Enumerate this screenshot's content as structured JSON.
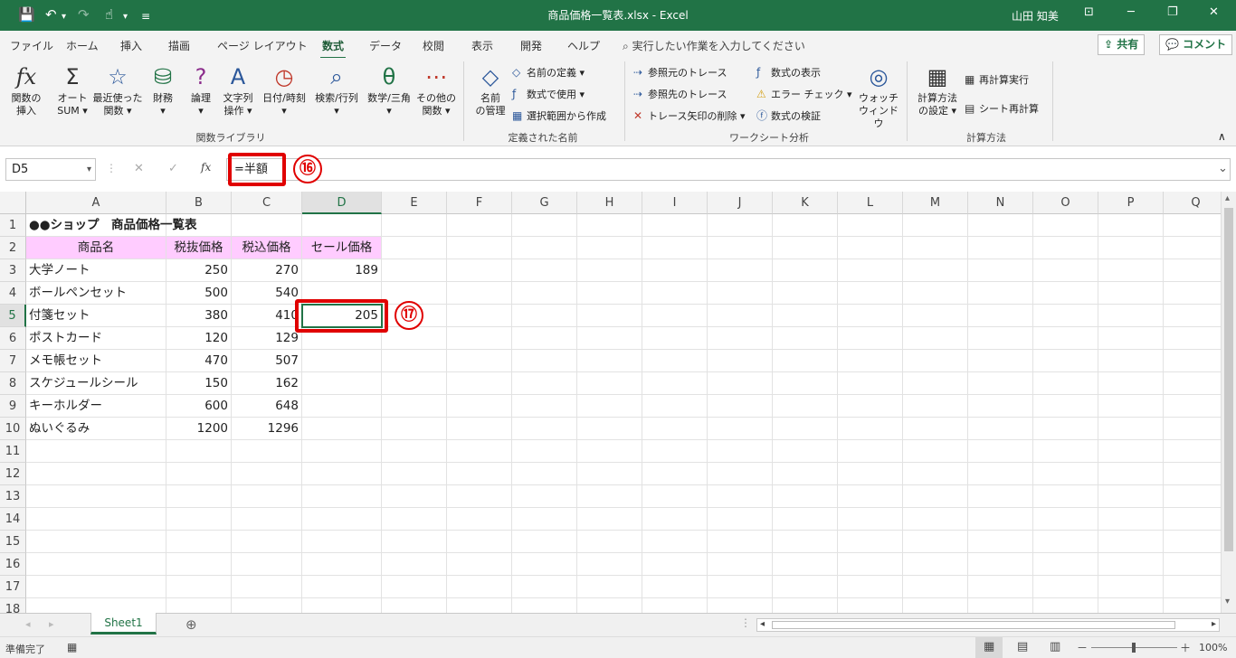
{
  "window": {
    "title": "商品価格一覧表.xlsx - Excel",
    "user": "山田 知美",
    "ribbon_display_glyph": "⊡",
    "minimize_glyph": "─",
    "restore_glyph": "❐",
    "close_glyph": "✕"
  },
  "qat": {
    "save_glyph": "💾",
    "undo_glyph": "↶",
    "dropdown_glyph": "▾",
    "redo_glyph": "↷",
    "touch_glyph": "☝",
    "customize_glyph": "≡"
  },
  "tabs": [
    "ファイル",
    "ホーム",
    "挿入",
    "描画",
    "ページ レイアウト",
    "数式",
    "データ",
    "校閲",
    "表示",
    "開発",
    "ヘルプ"
  ],
  "active_tab": "数式",
  "tellme": "実行したい作業を入力してください",
  "tellme_icon": "⌕",
  "share_label": "共有",
  "share_icon": "⇪",
  "comment_label": "コメント",
  "comment_icon": "💬",
  "ribbon": {
    "insert_function": {
      "line1": "関数の",
      "line2": "挿入",
      "glyph": "fx"
    },
    "autosum": {
      "line1": "オート",
      "line2": "SUM ▾",
      "glyph": "Σ"
    },
    "recent": {
      "line1": "最近使った",
      "line2": "関数 ▾",
      "glyph": "☆"
    },
    "financial": {
      "line1": "財務",
      "line2": "▾",
      "glyph": "⛁"
    },
    "logical": {
      "line1": "論理",
      "line2": "▾",
      "glyph": "?"
    },
    "text": {
      "line1": "文字列",
      "line2": "操作 ▾",
      "glyph": "A"
    },
    "datetime": {
      "line1": "日付/時刻",
      "line2": "▾",
      "glyph": "◷"
    },
    "lookup": {
      "line1": "検索/行列",
      "line2": "▾",
      "glyph": "⌕"
    },
    "math": {
      "line1": "数学/三角",
      "line2": "▾",
      "glyph": "θ"
    },
    "more": {
      "line1": "その他の",
      "line2": "関数 ▾",
      "glyph": "⋯"
    },
    "group_library": "関数ライブラリ",
    "name_manager": {
      "line1": "名前",
      "line2": "の管理",
      "glyph": "◇"
    },
    "define_name": "名前の定義 ▾",
    "use_in_formula": "数式で使用 ▾",
    "create_from_selection": "選択範囲から作成",
    "group_names": "定義された名前",
    "trace_precedents": "参照元のトレース",
    "trace_dependents": "参照先のトレース",
    "remove_arrows": "トレース矢印の削除 ▾",
    "show_formulas": "数式の表示",
    "error_checking": "エラー チェック ▾",
    "evaluate_formula": "数式の検証",
    "watch_window": {
      "line1": "ウォッチ",
      "line2": "ウィンドウ",
      "glyph": "◎"
    },
    "group_audit": "ワークシート分析",
    "calc_options": {
      "line1": "計算方法",
      "line2": "の設定 ▾",
      "glyph": "▦"
    },
    "calc_now": "再計算実行",
    "calc_sheet": "シート再計算",
    "group_calc": "計算方法",
    "collapse_glyph": "∧",
    "small_icons": {
      "define_name": "◇",
      "use_in_formula": "ƒ",
      "create_from_selection": "▦",
      "trace_precedents": "⇢",
      "trace_dependents": "⇢",
      "remove_arrows": "✕",
      "show_formulas": "ƒ",
      "error_checking": "⚠",
      "evaluate_formula": "ⓕ",
      "calc_now": "▦",
      "calc_sheet": "▤"
    }
  },
  "formula_bar": {
    "name_box": "D5",
    "name_box_dropdown": "▾",
    "cancel_glyph": "✕",
    "enter_glyph": "✓",
    "fx": "fx",
    "formula": "=半額",
    "expand_glyph": "⌄",
    "more_glyph": "⋮"
  },
  "annotations": {
    "n16": "⑯",
    "n17": "⑰"
  },
  "grid": {
    "columns": [
      "A",
      "B",
      "C",
      "D",
      "E",
      "F",
      "G",
      "H",
      "I",
      "J",
      "K",
      "L",
      "M",
      "N",
      "O",
      "P",
      "Q"
    ],
    "rows": [
      "1",
      "2",
      "3",
      "4",
      "5",
      "6",
      "7",
      "8",
      "9",
      "10",
      "11",
      "12",
      "13",
      "14",
      "15",
      "16",
      "17",
      "18"
    ],
    "data": [
      [
        "●●ショップ　商品価格一覧表",
        "",
        "",
        ""
      ],
      [
        "商品名",
        "税抜価格",
        "税込価格",
        "セール価格"
      ],
      [
        "大学ノート",
        "250",
        "270",
        "189"
      ],
      [
        "ボールペンセット",
        "500",
        "540",
        ""
      ],
      [
        "付箋セット",
        "380",
        "410",
        "205"
      ],
      [
        "ポストカード",
        "120",
        "129",
        ""
      ],
      [
        "メモ帳セット",
        "470",
        "507",
        ""
      ],
      [
        "スケジュールシール",
        "150",
        "162",
        ""
      ],
      [
        "キーホルダー",
        "600",
        "648",
        ""
      ],
      [
        "ぬいぐるみ",
        "1200",
        "1296",
        ""
      ]
    ]
  },
  "sheet_tab": "Sheet1",
  "add_sheet_glyph": "⊕",
  "nav_prev_glyph": "◂",
  "nav_next_glyph": "▸",
  "hscroll_left_glyph": "◂",
  "hscroll_right_glyph": "▸",
  "vscroll_up_glyph": "▴",
  "vscroll_down_glyph": "▾",
  "status": {
    "ready": "準備完了",
    "macro_glyph": "▦",
    "zoom": "100%",
    "normal_glyph": "▦",
    "layout_glyph": "▤",
    "pagebreak_glyph": "▥",
    "zoom_out": "－",
    "zoom_in": "＋"
  },
  "colors": {
    "excel_green": "#217346",
    "header_pink": "#ffccff",
    "annotation_red": "#e00000"
  }
}
